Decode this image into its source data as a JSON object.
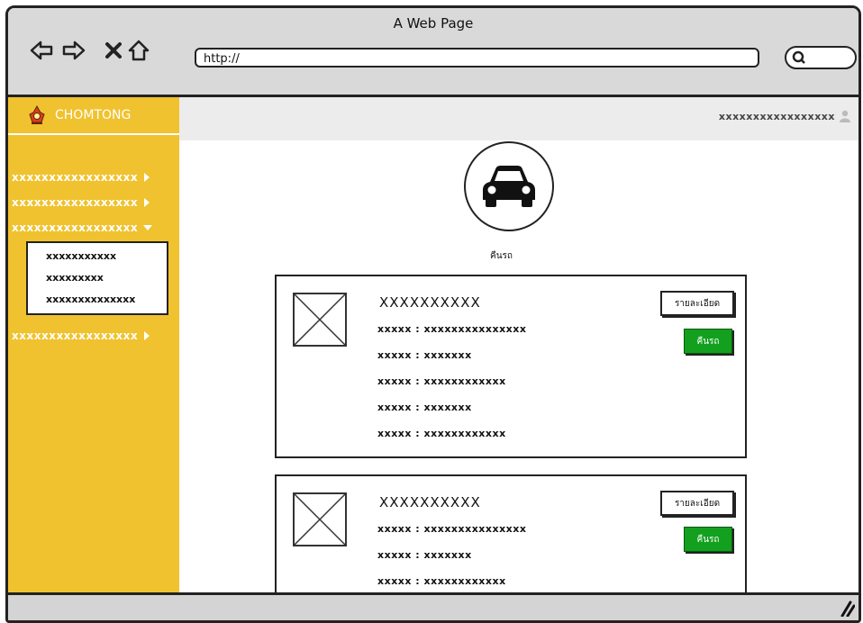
{
  "window": {
    "title": "A Web Page"
  },
  "address": {
    "url": "http://"
  },
  "brand": {
    "name": "CHOMTONG"
  },
  "user": {
    "name": "xxxxxxxxxxxxxxxxx"
  },
  "sidebar": {
    "items": [
      {
        "label": "xxxxxxxxxxxxxxxxx"
      },
      {
        "label": "xxxxxxxxxxxxxxxxx"
      },
      {
        "label": "xxxxxxxxxxxxxxxxx"
      },
      {
        "label": "xxxxxxxxxxxxxxxxx"
      }
    ],
    "submenu": [
      {
        "label": "xxxxxxxxxxx"
      },
      {
        "label": "xxxxxxxxx"
      },
      {
        "label": "xxxxxxxxxxxxxx"
      }
    ]
  },
  "main": {
    "heading": "คืนรถ"
  },
  "cards": [
    {
      "title": "XXXXXXXXXX",
      "fields": [
        "xxxxx : xxxxxxxxxxxxxxx",
        "xxxxx : xxxxxxx",
        "xxxxx : xxxxxxxxxxxx",
        "xxxxx : xxxxxxx",
        "xxxxx : xxxxxxxxxxxx"
      ],
      "detail_label": "รายละเอียด",
      "return_label": "คืนรถ"
    },
    {
      "title": "XXXXXXXXXX",
      "fields": [
        "xxxxx : xxxxxxxxxxxxxxx",
        "xxxxx : xxxxxxx",
        "xxxxx : xxxxxxxxxxxx"
      ],
      "detail_label": "รายละเอียด",
      "return_label": "คืนรถ"
    }
  ],
  "colors": {
    "sidebar": "#f0c22f",
    "accent_green": "#12a01e"
  }
}
